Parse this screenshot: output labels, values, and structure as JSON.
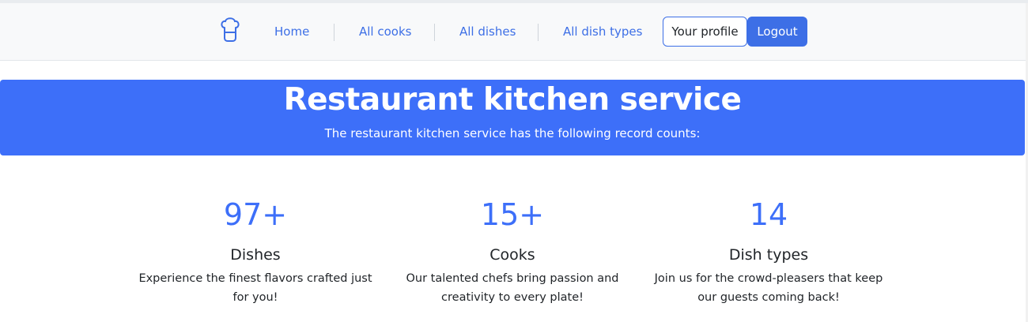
{
  "nav": {
    "logo_icon": "chef-hat-icon",
    "links": [
      "Home",
      "All cooks",
      "All dishes",
      "All dish types"
    ],
    "profile_label": "Your profile",
    "logout_label": "Logout"
  },
  "hero": {
    "title": "Restaurant kitchen service",
    "subtitle": "The restaurant kitchen service has the following record counts:"
  },
  "stats": [
    {
      "number": "97+",
      "title": "Dishes",
      "description": "Experience the finest flavors crafted just for you!"
    },
    {
      "number": "15+",
      "title": "Cooks",
      "description": "Our talented chefs bring passion and creativity to every plate!"
    },
    {
      "number": "14",
      "title": "Dish types",
      "description": "Join us for the crowd-pleasers that keep our guests coming back!"
    }
  ],
  "colors": {
    "accent": "#3d6ff9",
    "link": "#3d6fe6",
    "navbar_bg": "#f8f9fa"
  }
}
